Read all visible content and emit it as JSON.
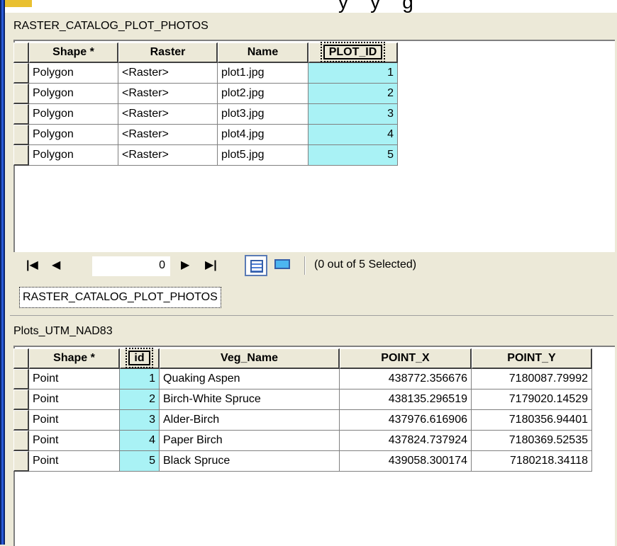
{
  "window_top_fragment": "y    y    g",
  "table1": {
    "caption": "RASTER_CATALOG_PLOT_PHOTOS",
    "columns": [
      "Shape *",
      "Raster",
      "Name",
      "PLOT_ID"
    ],
    "rows": [
      [
        "Polygon",
        "<Raster>",
        "plot1.jpg",
        "1"
      ],
      [
        "Polygon",
        "<Raster>",
        "plot2.jpg",
        "2"
      ],
      [
        "Polygon",
        "<Raster>",
        "plot3.jpg",
        "3"
      ],
      [
        "Polygon",
        "<Raster>",
        "plot4.jpg",
        "4"
      ],
      [
        "Polygon",
        "<Raster>",
        "plot5.jpg",
        "5"
      ]
    ]
  },
  "navigator": {
    "first_icon": "first-record-icon",
    "prev_icon": "previous-record-icon",
    "record_value": "0",
    "next_icon": "next-record-icon",
    "last_icon": "last-record-icon",
    "show_all_icon": "show-all-records-icon",
    "show_selected_icon": "show-selected-records-icon",
    "status": "(0 out of 5 Selected)"
  },
  "tab_label": "RASTER_CATALOG_PLOT_PHOTOS",
  "table2": {
    "caption": "Plots_UTM_NAD83",
    "columns": [
      "Shape *",
      "id",
      "Veg_Name",
      "POINT_X",
      "POINT_Y"
    ],
    "rows": [
      [
        "Point",
        "1",
        "Quaking Aspen",
        "438772.356676",
        "7180087.79992"
      ],
      [
        "Point",
        "2",
        "Birch-White Spruce",
        "438135.296519",
        "7179020.14529"
      ],
      [
        "Point",
        "3",
        "Alder-Birch",
        "437976.616906",
        "7180356.94401"
      ],
      [
        "Point",
        "4",
        "Paper Birch",
        "437824.737924",
        "7180369.52535"
      ],
      [
        "Point",
        "5",
        "Black Spruce",
        "439058.300174",
        "7180218.34118"
      ]
    ]
  },
  "colors": {
    "highlight_column": "#a9f2f5",
    "background": "#ece9d8"
  }
}
